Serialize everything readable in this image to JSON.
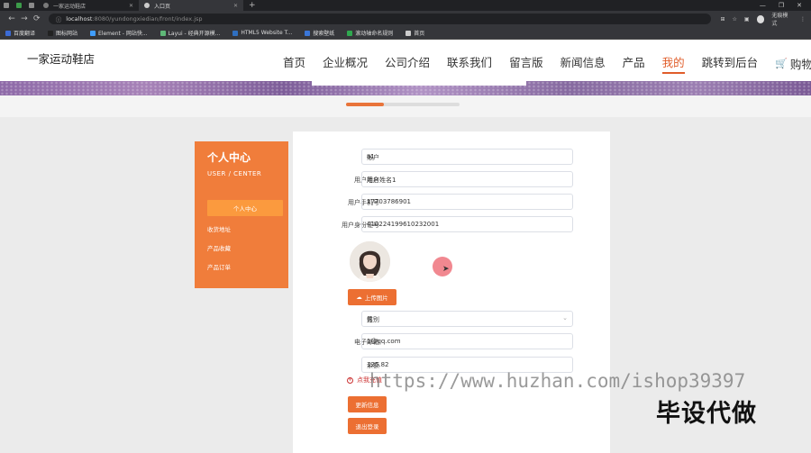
{
  "browser": {
    "tabs": [
      {
        "label": "一家运动鞋店",
        "active": false
      },
      {
        "label": "入口页",
        "active": true
      }
    ],
    "new_tab": "+",
    "window_controls": [
      "—",
      "❐",
      "✕"
    ],
    "url_host": "localhost",
    "url_path": ":8080/yundongxiedian/front/index.jsp",
    "profile_label": "无痕模式",
    "bookmarks": [
      {
        "label": "百度翻译",
        "color": "#3b6bd6"
      },
      {
        "label": "图标网站",
        "color": "#222"
      },
      {
        "label": "Element - 网站快...",
        "color": "#409eff"
      },
      {
        "label": "Layui - 经典开源模...",
        "color": "#5fb878"
      },
      {
        "label": "HTML5 Website T...",
        "color": "#2f6fc0"
      },
      {
        "label": "搜索壁纸",
        "color": "#3a76d8"
      },
      {
        "label": "滚动轴命名规则",
        "color": "#2fa84f"
      },
      {
        "label": "首页",
        "color": "#ccc"
      }
    ]
  },
  "site": {
    "logo": "一家运动鞋店",
    "nav": [
      "首页",
      "企业概况",
      "公司介绍",
      "联系我们",
      "留言版",
      "新闻信息",
      "产品",
      "我的",
      "跳转到后台"
    ],
    "cart_label": "购物车",
    "active_nav": "我的",
    "accent": "#e05d2a"
  },
  "sidebar": {
    "title": "个人中心",
    "subtitle": "USER / CENTER",
    "items": [
      "个人中心",
      "收货地址",
      "产品收藏",
      "产品订单"
    ],
    "bg": "#f07d3b"
  },
  "form": {
    "fields": [
      {
        "label": "账户",
        "value": "a1"
      },
      {
        "label": "用户姓名",
        "value": "用户姓名1"
      },
      {
        "label": "用户手机号",
        "value": "17703786901"
      },
      {
        "label": "用户身份证号",
        "value": "410224199610232001"
      }
    ],
    "upload_label": "上传图片",
    "gender_label": "性别",
    "gender_value": "男",
    "email_label": "电子邮箱",
    "email_value": "1@qq.com",
    "balance_label": "余额",
    "balance_value": "125.82",
    "recharge_label": "点我充值",
    "update_button": "更新信息",
    "logout_button": "退出登录"
  },
  "watermarks": {
    "url": "https://www.huzhan.com/ishop39397",
    "text": "毕设代做"
  }
}
